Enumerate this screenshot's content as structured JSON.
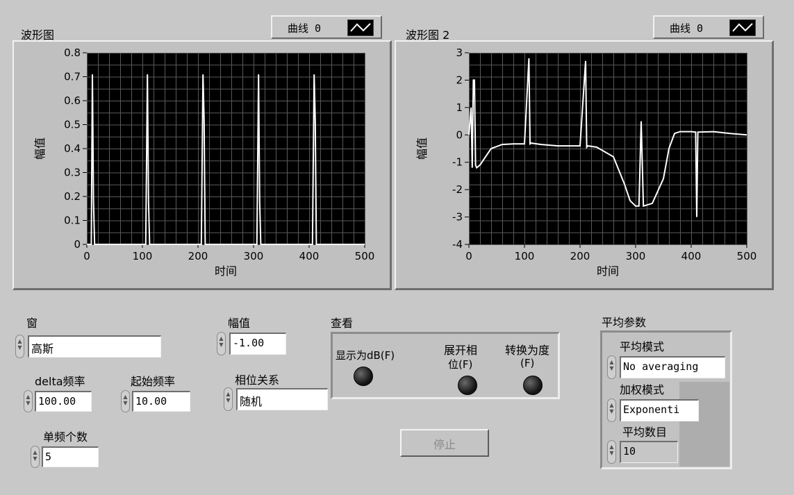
{
  "graph1": {
    "title": "波形图",
    "legend_label": "曲线 0",
    "xlabel": "时间",
    "ylabel": "幅值",
    "x_ticks": [
      "0",
      "100",
      "200",
      "300",
      "400",
      "500"
    ],
    "y_ticks": [
      "0",
      "0.1",
      "0.2",
      "0.3",
      "0.4",
      "0.5",
      "0.6",
      "0.7",
      "0.8"
    ]
  },
  "graph2": {
    "title": "波形图 2",
    "legend_label": "曲线 0",
    "xlabel": "时间",
    "ylabel": "幅值",
    "x_ticks": [
      "0",
      "100",
      "200",
      "300",
      "400",
      "500"
    ],
    "y_ticks": [
      "-4",
      "-3",
      "-2",
      "-1",
      "0",
      "1",
      "2",
      "3"
    ]
  },
  "chart_data": [
    {
      "type": "line",
      "xlabel": "时间",
      "ylabel": "幅值",
      "xlim": [
        0,
        500
      ],
      "ylim": [
        0,
        0.8
      ],
      "grid": true,
      "series": [
        {
          "name": "曲线 0",
          "x": [
            0,
            8,
            10,
            12,
            14,
            106,
            109,
            111,
            113,
            206,
            209,
            211,
            213,
            306,
            309,
            311,
            313,
            406,
            409,
            411,
            413,
            500
          ],
          "y": [
            0,
            0,
            0.71,
            0.18,
            0,
            0,
            0.71,
            0.18,
            0,
            0,
            0.71,
            0.52,
            0,
            0,
            0.71,
            0.18,
            0,
            0,
            0.71,
            0.52,
            0,
            0
          ]
        }
      ]
    },
    {
      "type": "line",
      "xlabel": "时间",
      "ylabel": "幅值",
      "xlim": [
        0,
        500
      ],
      "ylim": [
        -4,
        3
      ],
      "grid": true,
      "series": [
        {
          "name": "曲线 0",
          "x": [
            0,
            2,
            4,
            6,
            8,
            10,
            12,
            14,
            20,
            30,
            40,
            60,
            80,
            100,
            108,
            110,
            112,
            130,
            160,
            200,
            210,
            212,
            214,
            230,
            260,
            280,
            290,
            300,
            306,
            310,
            314,
            330,
            350,
            360,
            370,
            380,
            400,
            408,
            410,
            412,
            440,
            470,
            500
          ],
          "y": [
            0,
            0.5,
            1,
            -1.2,
            2,
            2,
            -1.1,
            -1.2,
            -1.1,
            -0.8,
            -0.5,
            -0.35,
            -0.33,
            -0.33,
            2.8,
            -0.33,
            -0.3,
            -0.35,
            -0.4,
            -0.4,
            2.7,
            -0.45,
            -0.4,
            -0.45,
            -0.8,
            -1.8,
            -2.4,
            -2.6,
            -2.6,
            0.5,
            -2.6,
            -2.5,
            -1.6,
            -0.5,
            0.05,
            0.12,
            0.12,
            0.1,
            -3.0,
            0.1,
            0.12,
            0.05,
            0
          ]
        }
      ]
    }
  ],
  "controls": {
    "window": {
      "label": "窗",
      "value": "高斯"
    },
    "delta_freq": {
      "label": "delta频率",
      "value": "100.00"
    },
    "start_freq": {
      "label": "起始频率",
      "value": "10.00"
    },
    "tone_count": {
      "label": "单频个数",
      "value": "5"
    },
    "amplitude": {
      "label": "幅值",
      "value": "-1.00"
    },
    "phase": {
      "label": "相位关系",
      "value": "随机"
    }
  },
  "view": {
    "title": "查看",
    "show_db": "显示为dB(F)",
    "unwrap_line1": "展开相",
    "unwrap_line2": "位(F)",
    "convert_line1": "转换为度",
    "convert_line2": "(F)"
  },
  "stop_label": "停止",
  "averaging": {
    "title": "平均参数",
    "mode_label": "平均模式",
    "mode_value": "No averaging",
    "weight_label": "加权模式",
    "weight_value": "Exponenti",
    "count_label": "平均数目",
    "count_value": "10"
  },
  "colors": {
    "background": "#c8c8c8",
    "plot_bg": "#000000",
    "grid": "#5a5a5a",
    "trace": "#ffffff"
  }
}
